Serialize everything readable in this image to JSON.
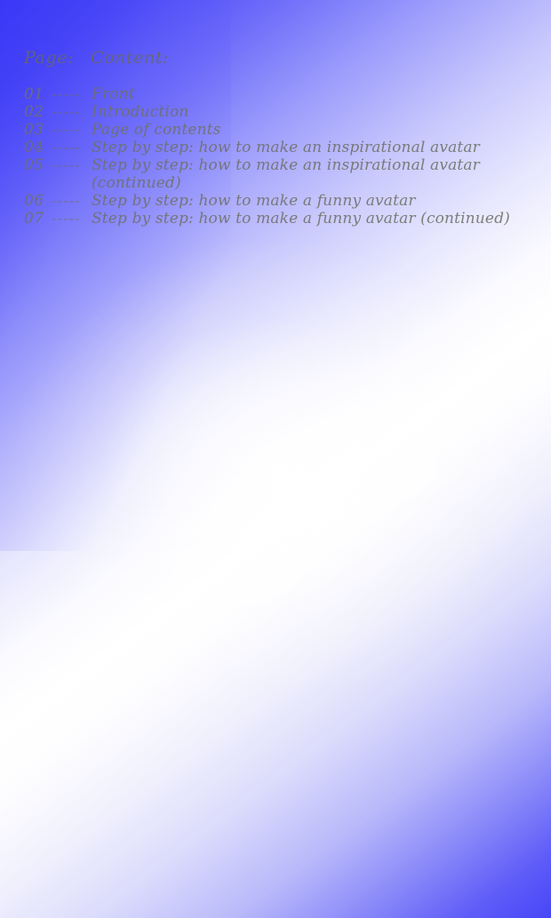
{
  "document": {
    "kind": "table-of-contents-page",
    "background": {
      "style": "diagonal-gradient",
      "corner_top_left": "#3A38F6",
      "corner_bottom_right": "#4746F7",
      "center": "#FFFFFF",
      "text_color": "#6F706B"
    }
  },
  "header": {
    "page_label": "Page:",
    "content_label": "Content:"
  },
  "entries": [
    {
      "number": "01",
      "dashes": "-----",
      "title": "Front",
      "continuation": null
    },
    {
      "number": "02",
      "dashes": "-----",
      "title": "Introduction",
      "continuation": null
    },
    {
      "number": "03",
      "dashes": "-----",
      "title": "Page of contents",
      "continuation": null
    },
    {
      "number": "04",
      "dashes": "-----",
      "title": "Step by step: how to make an inspirational avatar",
      "continuation": null
    },
    {
      "number": "05",
      "dashes": "-----",
      "title": "Step by step: how to make an inspirational avatar",
      "continuation": "(continued)"
    },
    {
      "number": "06",
      "dashes": "-----",
      "title": "Step by step: how to make a funny avatar",
      "continuation": null
    },
    {
      "number": "07",
      "dashes": "-----",
      "title": "Step by step: how to make a funny avatar (continued)",
      "continuation": null
    }
  ]
}
